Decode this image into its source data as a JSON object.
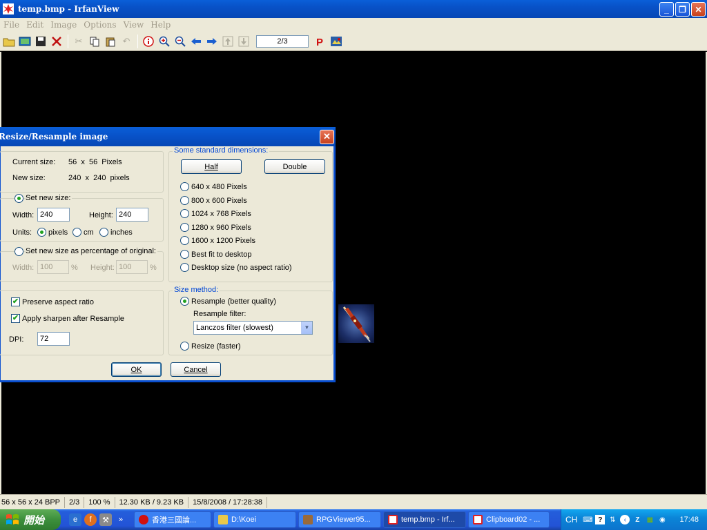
{
  "window": {
    "title": "temp.bmp - IrfanView",
    "minimize": "_",
    "maximize": "❐",
    "close": "✕"
  },
  "menu": [
    "File",
    "Edit",
    "Image",
    "Options",
    "View",
    "Help"
  ],
  "toolbar": {
    "page_indicator": "2/3"
  },
  "status": {
    "dimensions": "56 x 56 x 24 BPP",
    "page": "2/3",
    "zoom": "100 %",
    "filesize": "12.30 KB / 9.23 KB",
    "datetime": "15/8/2008 / 17:28:38"
  },
  "dialog": {
    "title": "Resize/Resample image",
    "close": "✕",
    "current_size_label": "Current size:",
    "current_size_value": "56  x  56  Pixels",
    "new_size_label": "New size:",
    "new_size_value": "240  x  240  pixels",
    "set_new_size_label": "Set new size:",
    "width_label": "Width:",
    "width_value": "240",
    "height_label": "Height:",
    "height_value": "240",
    "units_label": "Units:",
    "unit_pixels": "pixels",
    "unit_cm": "cm",
    "unit_inches": "inches",
    "percentage_label": "Set new size as percentage of original:",
    "pct_width_label": "Width:",
    "pct_width_value": "100",
    "pct_height_label": "Height:",
    "pct_height_value": "100",
    "pct_sign": "%",
    "preserve_aspect": "Preserve aspect ratio",
    "apply_sharpen": "Apply sharpen after Resample",
    "dpi_label": "DPI:",
    "dpi_value": "72",
    "std_dims_title": "Some standard dimensions:",
    "half_button": "Half",
    "double_button": "Double",
    "dims": [
      "640 x 480 Pixels",
      "800 x 600 Pixels",
      "1024 x 768 Pixels",
      "1280 x 960 Pixels",
      "1600 x 1200 Pixels",
      "Best fit to desktop",
      "Desktop size (no aspect ratio)"
    ],
    "size_method_title": "Size method:",
    "resample_label": "Resample (better quality)",
    "resample_filter_label": "Resample filter:",
    "resample_filter_value": "Lanczos filter (slowest)",
    "resize_label": "Resize (faster)",
    "ok_button": "OK",
    "cancel_button": "Cancel"
  },
  "taskbar": {
    "start_label": "開始",
    "tasks": [
      "香港三國論...",
      "D:\\Koei",
      "RPGViewer95...",
      "temp.bmp - Irf...",
      "Clipboard02 - ..."
    ],
    "lang": "CH",
    "clock": "17:48"
  }
}
